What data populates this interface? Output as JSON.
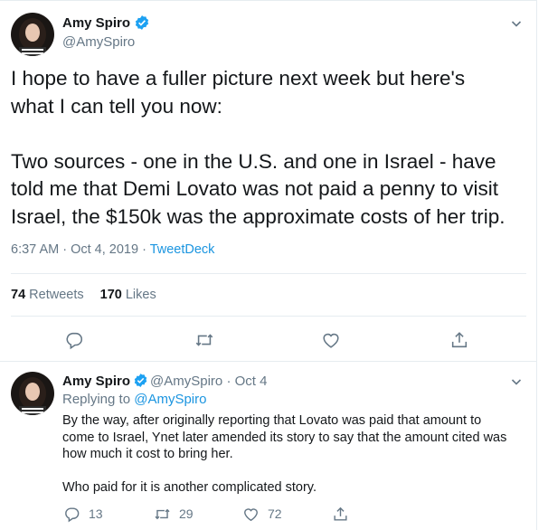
{
  "main_tweet": {
    "author_name": "Amy Spiro",
    "author_handle": "@AmySpiro",
    "text": "I hope to have a fuller picture next week but here's\nwhat I can tell you now:\n\nTwo sources - one in the U.S. and one in Israel - have\ntold me that Demi Lovato was not paid a penny to visit\nIsrael, the $150k was the approximate costs of her trip.",
    "timestamp": "6:37 AM · Oct 4, 2019 · ",
    "source": "TweetDeck",
    "retweets_count": "74",
    "retweets_label": "Retweets",
    "likes_count": "170",
    "likes_label": "Likes"
  },
  "reply_tweet": {
    "author_name": "Amy Spiro",
    "author_handle": "@AmySpiro",
    "date": "· Oct 4",
    "replying_label": "Replying to ",
    "replying_to": "@AmySpiro",
    "text": "By the way, after originally reporting that Lovato was paid that amount to\ncome to Israel, Ynet later amended its story to say that the amount cited was\nhow much it cost to bring her.\n\nWho paid for it is another complicated story.",
    "reply_count": "13",
    "retweet_count": "29",
    "like_count": "72"
  },
  "icons": [
    "verified-badge-icon",
    "chevron-down-icon",
    "reply-icon",
    "retweet-icon",
    "like-icon",
    "share-icon"
  ],
  "colors": {
    "accent": "#1da1f2",
    "link": "#1b95e0",
    "muted": "#657786",
    "text": "#14171a",
    "border": "#e6ecf0"
  }
}
